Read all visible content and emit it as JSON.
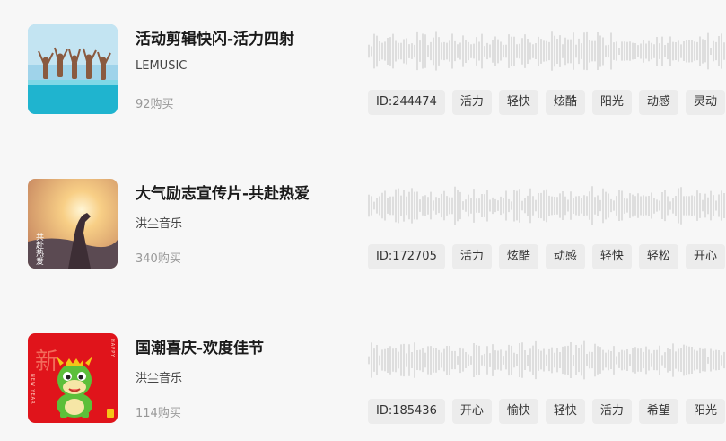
{
  "tracks": [
    {
      "title": "活动剪辑快闪-活力四射",
      "author": "LEMUSIC",
      "purchases": "92购买",
      "id_label": "ID:244474",
      "tags": [
        "活力",
        "轻快",
        "炫酷",
        "阳光",
        "动感",
        "灵动"
      ],
      "cover_colors": {
        "sky": "#9fd3ea",
        "water": "#1fb4cf"
      }
    },
    {
      "title": "大气励志宣传片-共赴热爱",
      "author": "洪尘音乐",
      "purchases": "340购买",
      "id_label": "ID:172705",
      "tags": [
        "活力",
        "炫酷",
        "动感",
        "轻快",
        "轻松",
        "开心"
      ],
      "cover_colors": {
        "sky": "#f4c27a",
        "ground": "#5b4a52"
      },
      "cover_text": "共赴热爱"
    },
    {
      "title": "国潮喜庆-欢度佳节",
      "author": "洪尘音乐",
      "purchases": "114购买",
      "id_label": "ID:185436",
      "tags": [
        "开心",
        "愉快",
        "轻快",
        "活力",
        "希望",
        "阳光"
      ],
      "cover_colors": {
        "bg": "#e0141b",
        "dragon": "#5cbf3a"
      },
      "cover_text": "新",
      "cover_side_left": "NEW YEAR",
      "cover_side_right": "HAPPY"
    }
  ]
}
